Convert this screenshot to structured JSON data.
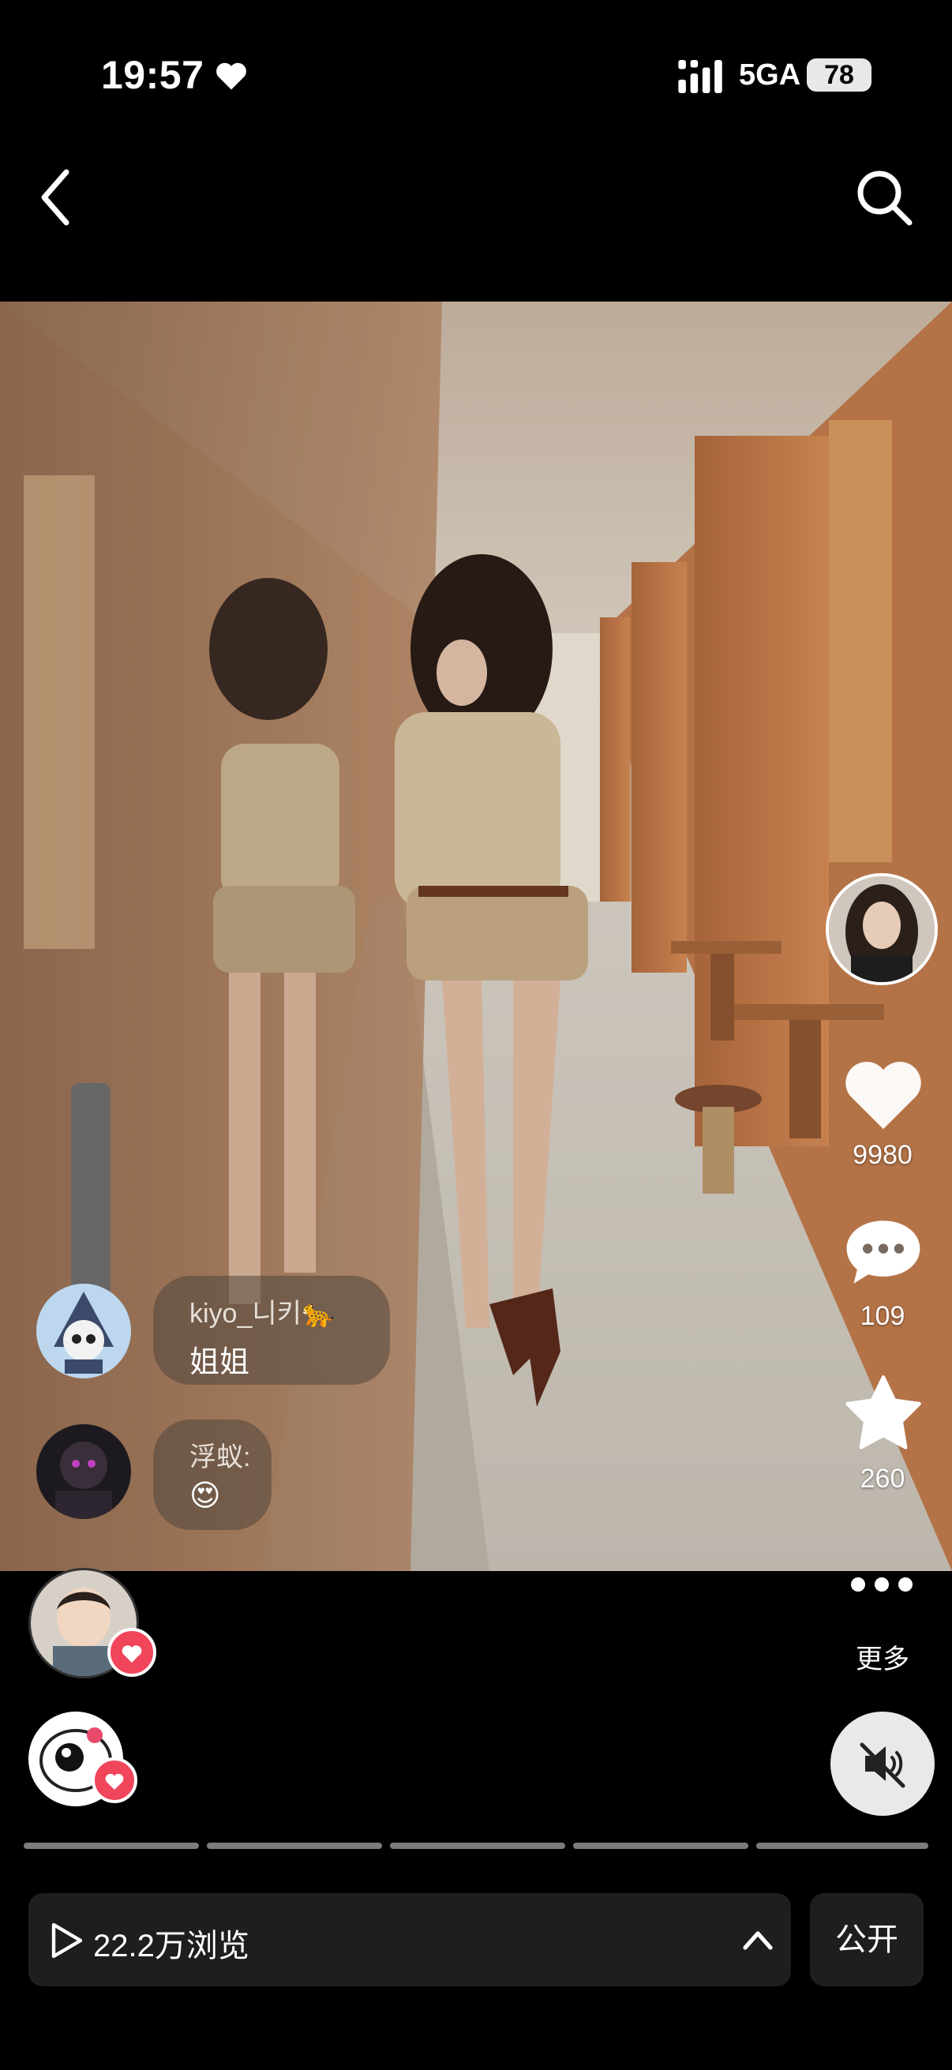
{
  "status_bar": {
    "time": "19:57",
    "network": "5GA",
    "battery": "78"
  },
  "nav": {
    "back_icon": "chevron-left-icon",
    "search_icon": "search-icon"
  },
  "actions": {
    "likes": "9980",
    "comments": "109",
    "favorites": "260"
  },
  "comments": [
    {
      "user": "kiyo_니키🐆",
      "text": "姐姐"
    },
    {
      "user": "浮蚁:",
      "text": "😍"
    }
  ],
  "more_label": "更多",
  "footer": {
    "views": "22.2万浏览",
    "visibility": "公开"
  },
  "colors": {
    "background": "#000000",
    "like_badge": "#f0455a",
    "bar": "#1e1e1e"
  }
}
